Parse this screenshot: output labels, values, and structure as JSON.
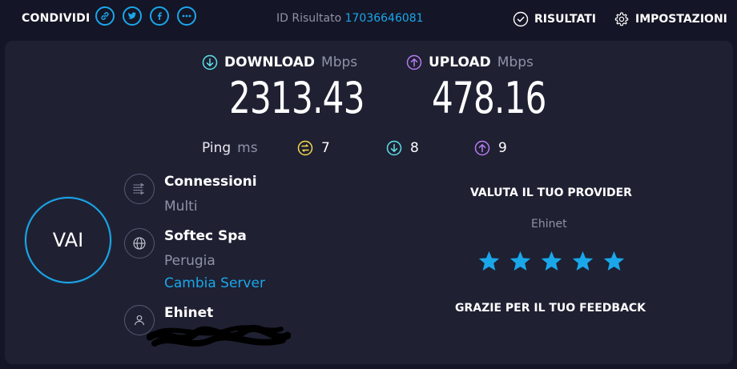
{
  "header": {
    "share_label": "CONDIVIDI",
    "share_buttons": [
      "link-icon",
      "twitter-icon",
      "facebook-icon",
      "more-icon"
    ],
    "result_id_label": "ID Risultato",
    "result_id_value": "17036646081",
    "results_label": "RISULTATI",
    "settings_label": "IMPOSTAZIONI"
  },
  "download": {
    "label": "DOWNLOAD",
    "unit": "Mbps",
    "value": "2313.43",
    "icon": "download-arrow-icon",
    "color": "#5de0e6"
  },
  "upload": {
    "label": "UPLOAD",
    "unit": "Mbps",
    "value": "478.16",
    "icon": "upload-arrow-icon",
    "color": "#b57cf2"
  },
  "ping": {
    "label": "Ping",
    "unit": "ms",
    "idle": "7",
    "download": "8",
    "upload": "9",
    "colors": {
      "idle": "#f2d94e",
      "download": "#5de0e6",
      "upload": "#b57cf2"
    }
  },
  "go_button": {
    "label": "VAI"
  },
  "connections": {
    "title": "Connessioni",
    "value": "Multi"
  },
  "server": {
    "name": "Softec Spa",
    "location": "Perugia",
    "change_label": "Cambia Server"
  },
  "provider": {
    "name": "Ehinet"
  },
  "rating": {
    "title": "VALUTA IL TUO PROVIDER",
    "provider_name": "Ehinet",
    "stars": 5,
    "star_color": "#1aa7ea",
    "thanks": "GRAZIE PER IL TUO FEEDBACK"
  },
  "accent": "#1aa7ea"
}
